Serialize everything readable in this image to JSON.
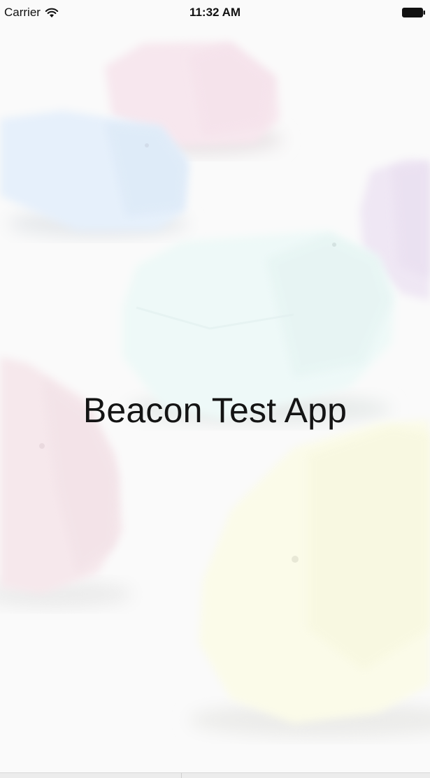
{
  "status_bar": {
    "carrier": "Carrier",
    "time": "11:32 AM"
  },
  "splash": {
    "title": "Beacon Test App"
  },
  "icons": {
    "wifi": "wifi-icon",
    "battery": "battery-icon"
  },
  "colors": {
    "background": "#fafafa",
    "title_text": "#141414"
  }
}
